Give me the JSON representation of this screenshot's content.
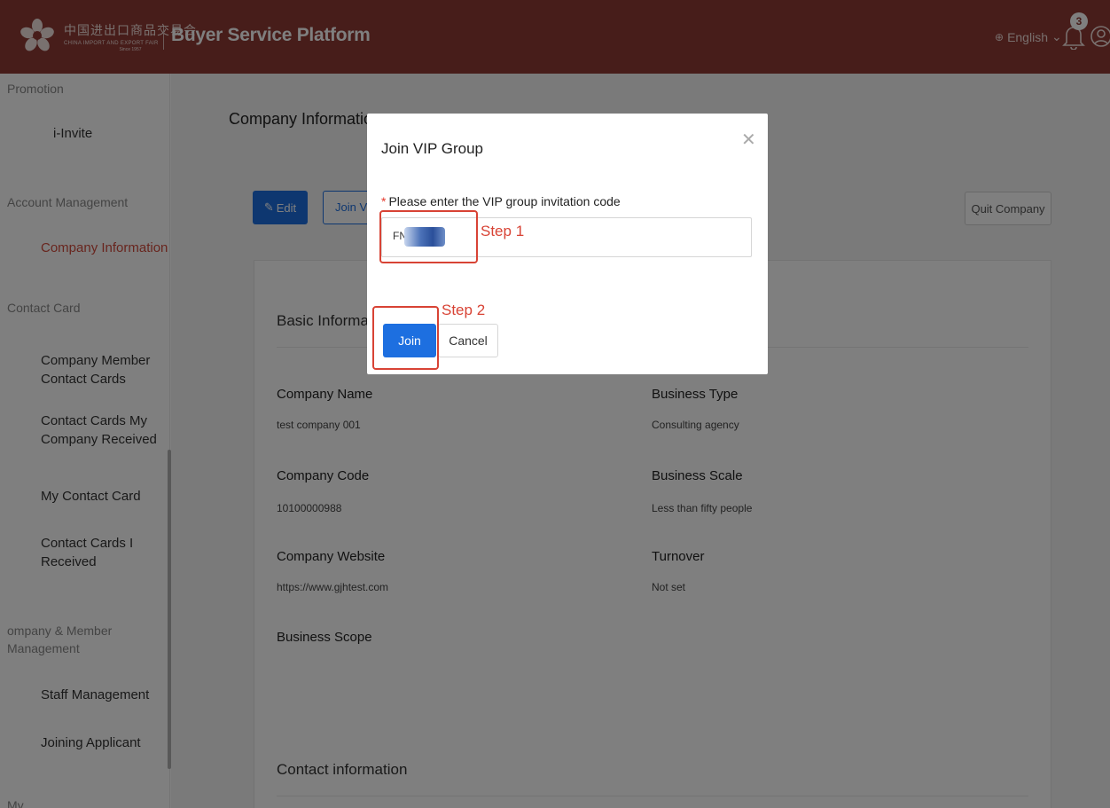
{
  "header": {
    "logo_cn": "中国进出口商品交易会",
    "logo_en": "CHINA IMPORT AND EXPORT FAIR",
    "logo_since": "Since 1957",
    "platform_title": "Buyer Service Platform",
    "language": "English",
    "notification_count": "3"
  },
  "sidebar": {
    "groups": [
      {
        "title": "Promotion",
        "items": [
          "i-Invite"
        ]
      },
      {
        "title": "Account Management",
        "items": [
          "Company Information"
        ]
      },
      {
        "title": "Contact Card",
        "items": [
          "Company Member Contact Cards",
          "Contact Cards My Company Received",
          "My Contact Card",
          "Contact Cards I Received"
        ]
      },
      {
        "title": "ompany & Member Management",
        "items": [
          "Staff Management",
          "Joining Applicant"
        ]
      }
    ],
    "active_item": "Company Information",
    "partial_bottom": "My"
  },
  "page": {
    "title": "Company Information",
    "edit_label": "Edit",
    "join_vip_label": "Join VIP Group",
    "quit_label": "Quit Company"
  },
  "basic_info": {
    "title": "Basic Information",
    "fields": [
      {
        "label": "Company Name",
        "value": "test company 001"
      },
      {
        "label": "Business Type",
        "value": "Consulting agency"
      },
      {
        "label": "Company Code",
        "value": "10100000988"
      },
      {
        "label": "Business Scale",
        "value": "Less than fifty people"
      },
      {
        "label": "Company Website",
        "value": "https://www.gjhtest.com"
      },
      {
        "label": "Turnover",
        "value": "Not set"
      },
      {
        "label": "Business Scope",
        "value": ""
      }
    ]
  },
  "contact_info": {
    "title": "Contact information"
  },
  "modal": {
    "title": "Join VIP Group",
    "field_label": "Please enter the VIP group invitation code",
    "field_value": "FNX",
    "join_label": "Join",
    "cancel_label": "Cancel"
  },
  "annotations": {
    "step1": "Step 1",
    "step2": "Step 2",
    "color": "#d84335"
  },
  "colors": {
    "header_bg": "#8e3a34",
    "primary": "#1d6fe0",
    "active_menu": "#d14a3c"
  }
}
